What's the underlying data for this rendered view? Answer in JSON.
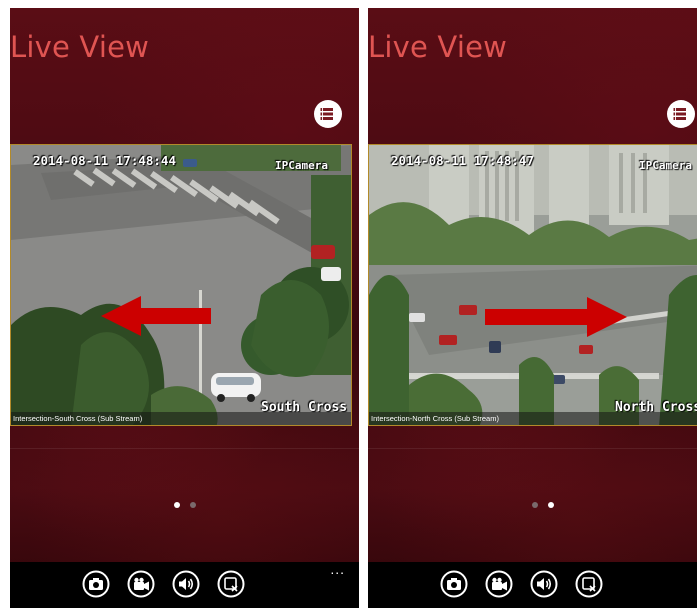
{
  "screens": [
    {
      "app_title": "Live View",
      "camera_overlay": {
        "timestamp": "2014-08-11 17:48:44",
        "camera_name": "IPCamera",
        "location_label": "South Cross"
      },
      "stream_caption": "Intersection-South Cross (Sub Stream)",
      "swipe_arrow_direction": "left",
      "page_indicator": {
        "count": 2,
        "active_index": 0
      }
    },
    {
      "app_title": "Live View",
      "camera_overlay": {
        "timestamp": "2014-08-11 17:48:47",
        "camera_name": "IPCamera",
        "location_label": "North Cross"
      },
      "stream_caption": "Intersection-North Cross (Sub Stream)",
      "swipe_arrow_direction": "right",
      "page_indicator": {
        "count": 2,
        "active_index": 1
      }
    }
  ],
  "app_bar": {
    "buttons": [
      {
        "icon": "camera-icon"
      },
      {
        "icon": "record-video-icon"
      },
      {
        "icon": "audio-icon"
      },
      {
        "icon": "close-view-icon"
      }
    ],
    "more_label": "..."
  },
  "colors": {
    "title": "#e05552",
    "swipe_arrow": "#cc0000",
    "app_bar": "#000000",
    "video_border": "#b28a2a"
  }
}
